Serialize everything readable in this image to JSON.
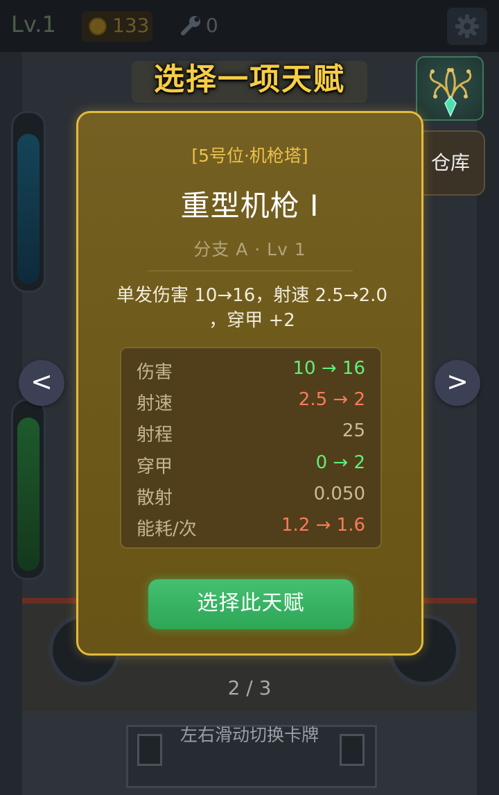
{
  "topbar": {
    "level": "Lv.1",
    "coins": "133",
    "tools": "0",
    "icons": {
      "coin": "coin-icon",
      "tools": "wrench-icon",
      "settings": "gear-icon"
    }
  },
  "overlay": {
    "title": "选择一项天赋",
    "warehouse_label": "仓库",
    "prev_label": "<",
    "next_label": ">",
    "talent_tree_icon": "talent-tree-icon"
  },
  "card": {
    "slot": "[5号位·机枪塔]",
    "name": "重型机枪 I",
    "branch": "分支 A · Lv 1",
    "desc_line1": "单发伤害 10→16，射速 2.5→2.0",
    "desc_line2": "，穿甲 +2",
    "stats": [
      {
        "label": "伤害",
        "value": "10 → 16",
        "color": "#5ff07a"
      },
      {
        "label": "射速",
        "value": "2.5 → 2",
        "color": "#ff7a5c"
      },
      {
        "label": "射程",
        "value": "25",
        "color": "#c9bc94"
      },
      {
        "label": "穿甲",
        "value": "0 → 2",
        "color": "#5ff07a"
      },
      {
        "label": "散射",
        "value": "0.050",
        "color": "#c9bc94"
      },
      {
        "label": "能耗/次",
        "value": "1.2 → 1.6",
        "color": "#ff7a5c"
      }
    ],
    "select_label": "选择此天赋"
  },
  "pager": "2 / 3",
  "hint": "左右滑动切换卡牌",
  "colors": {
    "accent": "#f6cd45",
    "card_border": "#e3bb3e",
    "select_button": "#34ad5d"
  }
}
